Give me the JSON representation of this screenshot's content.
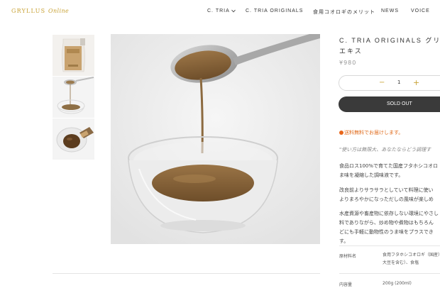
{
  "header": {
    "logo_main": "GRYLLUS",
    "logo_sub": "Online",
    "nav": [
      "C. TRIA",
      "C. TRIA ORIGINALS",
      "食用コオロギのメリット",
      "NEWS",
      "VOICE"
    ]
  },
  "product": {
    "title": "C. TRIA ORIGINALS グリ エキス",
    "price": "¥980",
    "quantity": "1",
    "soldout_label": "SOLD OUT",
    "shipping_note": "送料無料でお届けします。",
    "quote": "\"使い方は無限大、あなたならどう調理す",
    "paragraphs": [
      [
        "食品ロス100%で育てた国産フタホシコオロ",
        "ま味を凝縮した調味液です。"
      ],
      [
        "改良前よりサラサラとしていて料理に使い",
        "よりまろやかになっただしの風味が楽しめ"
      ],
      [
        "水産資源や畜産物に依存しない環境にやさし",
        "料でありながら、炒め物や煮物はもちろん",
        "どにも手軽に動物性のうま味をプラスでき",
        "す。"
      ]
    ],
    "specs": [
      {
        "label": "原材料名",
        "value": [
          "食用フタホシコオロギ（国産）",
          "大豆を含む）、食塩"
        ]
      },
      {
        "label": "内容量",
        "value": [
          "200g (200ml)"
        ]
      }
    ]
  },
  "colors": {
    "accent": "#c8a235",
    "soldout_bg": "#3a3a3a",
    "shipping": "#e06a1a"
  }
}
